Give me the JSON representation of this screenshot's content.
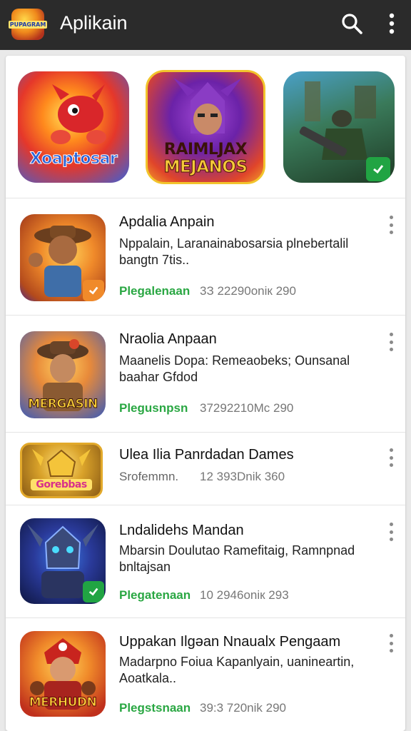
{
  "appbar": {
    "logo_text": "PUPAGRAM",
    "title": "Aplikain",
    "icons": {
      "search": "search-icon",
      "more": "more-vert-icon"
    }
  },
  "featured": [
    {
      "title": "Xoaptosar"
    },
    {
      "title_line1": "RAIMLJAX",
      "title_line2": "MEJANOS"
    },
    {
      "title": "",
      "badge": "check-icon"
    }
  ],
  "apps": [
    {
      "name": "Apdalia Anpain",
      "desc": "Nppalain, Laranainabosarsia plnebertalil bangtn 7tis..",
      "status": "Plegalenaan",
      "meta": "3З 22290oniк 290",
      "thumb_badge": "check-icon"
    },
    {
      "name": "Nraolia Anpaan",
      "desc": "Maanelis Dopa: Remeaobeks; Ounsanal baahar Gfdod",
      "status": "Plegusnpsn",
      "meta": "37292210Mс 290",
      "thumb_title": "MERGASIN"
    },
    {
      "name": "Ulea Ilia Panrdadan Dames",
      "desc": "",
      "status": "Srofemmn.",
      "meta": "12 393Dnik 360",
      "thumb_title": "Gorebbas"
    },
    {
      "name": "Lndalidehs Mandan",
      "desc": "Mbarsin Doulutao Ramefitaig, Ramnpnad bnltajsan",
      "status": "Plegatenaan",
      "meta": "10 2946oniк 293",
      "thumb_badge": "check-icon"
    },
    {
      "name": "Uppakan Ilgəan Nnaualx Pengaam",
      "desc": "Madarpno Foiua Kapanlyain, uanineartin, Aoatkala..",
      "status": "Plegstsnaan",
      "meta": "39:3 720nik 290",
      "thumb_title": "MERHUDN"
    }
  ],
  "colors": {
    "appbar": "#2b2b2b",
    "accent_green": "#2aa743",
    "badge_green": "#21a443"
  }
}
